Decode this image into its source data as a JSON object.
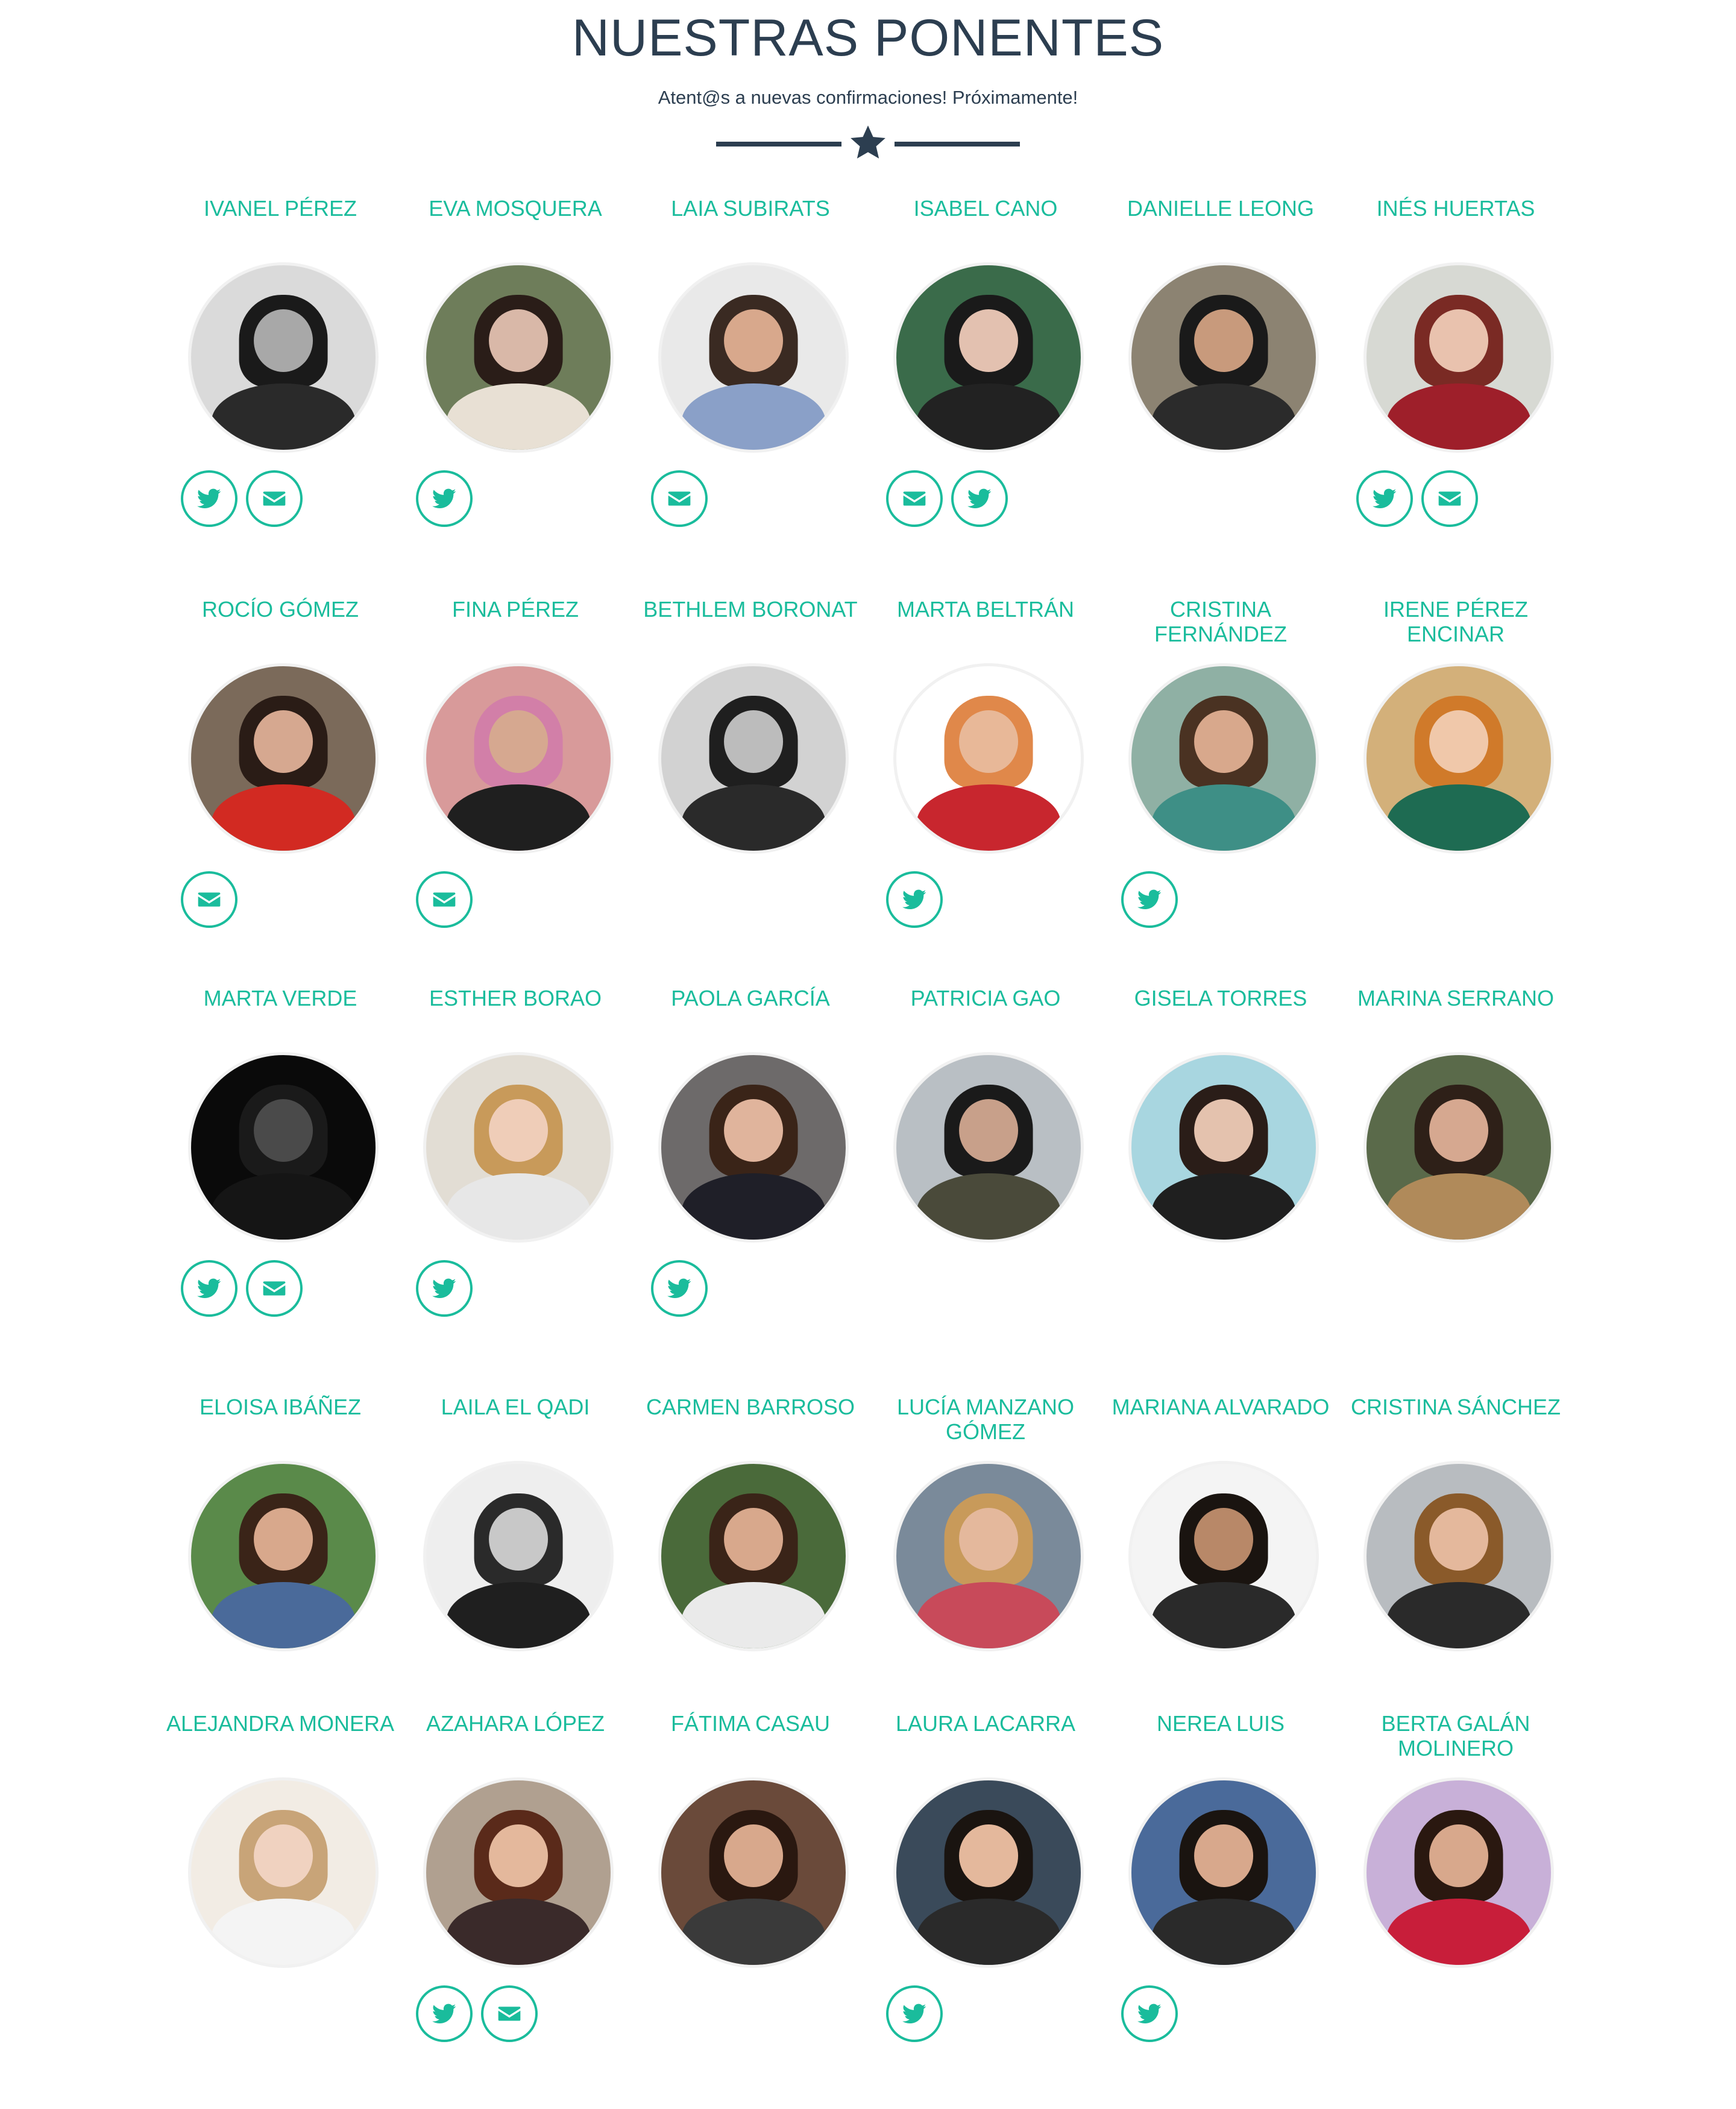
{
  "header": {
    "title": "NUESTRAS PONENTES",
    "subtitle": "Atent@s a nuevas confirmaciones! Próximamente!",
    "divider_icon": "star-icon"
  },
  "colors": {
    "accent": "#1abc9c",
    "heading": "#2c3e50",
    "background": "#ffffff"
  },
  "speakers": [
    {
      "name": "Ivanel Pérez",
      "icons": [
        "twitter-icon",
        "envelope-icon"
      ],
      "photo": {
        "bg": "#dadada",
        "hair": "#1a1a1a",
        "skin": "#a8a8a8",
        "clothes": "#2a2a2a"
      }
    },
    {
      "name": "Eva Mosquera",
      "icons": [
        "twitter-icon"
      ],
      "photo": {
        "bg": "#6e7d5a",
        "hair": "#2a1d18",
        "skin": "#d9b8a8",
        "clothes": "#e8e0d4"
      }
    },
    {
      "name": "Laia Subirats",
      "icons": [
        "envelope-icon"
      ],
      "photo": {
        "bg": "#e9e9e9",
        "hair": "#3a2a22",
        "skin": "#d8a88c",
        "clothes": "#8aa0c8"
      }
    },
    {
      "name": "Isabel Cano",
      "icons": [
        "envelope-icon",
        "twitter-icon"
      ],
      "photo": {
        "bg": "#3a6b4a",
        "hair": "#1a1a1a",
        "skin": "#e3c1b0",
        "clothes": "#222222"
      }
    },
    {
      "name": "Danielle Leong",
      "icons": [],
      "photo": {
        "bg": "#8c8372",
        "hair": "#1a1a1a",
        "skin": "#c89a7c",
        "clothes": "#2b2b2b"
      }
    },
    {
      "name": "Inés Huertas",
      "icons": [
        "twitter-icon",
        "envelope-icon"
      ],
      "photo": {
        "bg": "#d7d9d3",
        "hair": "#7a2a24",
        "skin": "#e9c2ae",
        "clothes": "#9e1f2a"
      }
    },
    {
      "name": "Rocío Gómez",
      "icons": [
        "envelope-icon"
      ],
      "photo": {
        "bg": "#7b6a5a",
        "hair": "#2a1c16",
        "skin": "#d6a890",
        "clothes": "#d22a22"
      }
    },
    {
      "name": "Fina Pérez",
      "icons": [
        "envelope-icon"
      ],
      "photo": {
        "bg": "#d89a9a",
        "hair": "#d27fa8",
        "skin": "#d6a890",
        "clothes": "#1f1f1f"
      }
    },
    {
      "name": "Bethlem Boronat",
      "icons": [],
      "photo": {
        "bg": "#d2d2d2",
        "hair": "#1f1f1f",
        "skin": "#bcbcbc",
        "clothes": "#2a2a2a"
      }
    },
    {
      "name": "Marta Beltrán",
      "icons": [
        "twitter-icon"
      ],
      "photo": {
        "bg": "#ffffff",
        "hair": "#e0884a",
        "skin": "#e8b898",
        "clothes": "#c8262e"
      }
    },
    {
      "name": "Cristina Fernández",
      "icons": [
        "twitter-icon"
      ],
      "photo": {
        "bg": "#8fb0a4",
        "hair": "#4a3222",
        "skin": "#d8a88c",
        "clothes": "#3e8f86"
      }
    },
    {
      "name": "Irene Pérez Encinar",
      "icons": [],
      "photo": {
        "bg": "#d3b07a",
        "hair": "#d07a2a",
        "skin": "#f0c8aa",
        "clothes": "#1e6b52"
      }
    },
    {
      "name": "Marta Verde",
      "icons": [
        "twitter-icon",
        "envelope-icon"
      ],
      "photo": {
        "bg": "#0a0a0a",
        "hair": "#1a1a1a",
        "skin": "#4a4a4a",
        "clothes": "#151515"
      }
    },
    {
      "name": "Esther Borao",
      "icons": [
        "twitter-icon"
      ],
      "photo": {
        "bg": "#e2ddd4",
        "hair": "#c89a5a",
        "skin": "#efcdb8",
        "clothes": "#e7e7e7"
      }
    },
    {
      "name": "Paola García",
      "icons": [
        "twitter-icon"
      ],
      "photo": {
        "bg": "#6d6a6a",
        "hair": "#3a2418",
        "skin": "#e0b49c",
        "clothes": "#1f1f28"
      }
    },
    {
      "name": "Patricia Gao",
      "icons": [],
      "photo": {
        "bg": "#b9bfc4",
        "hair": "#1a1a1a",
        "skin": "#c8a08a",
        "clothes": "#4a4a3a"
      }
    },
    {
      "name": "Gisela Torres",
      "icons": [],
      "photo": {
        "bg": "#a8d6e0",
        "hair": "#2a1d18",
        "skin": "#e4c2ae",
        "clothes": "#1f1f1f"
      }
    },
    {
      "name": "Marina Serrano",
      "icons": [],
      "photo": {
        "bg": "#5a6a4a",
        "hair": "#2e2018",
        "skin": "#d6a890",
        "clothes": "#b08a5a"
      }
    },
    {
      "name": "Eloisa Ibáñez",
      "icons": [],
      "photo": {
        "bg": "#5a8a4a",
        "hair": "#3a2418",
        "skin": "#d8a88c",
        "clothes": "#4a6a9a"
      }
    },
    {
      "name": "Laila El Qadi",
      "icons": [],
      "photo": {
        "bg": "#eeeeee",
        "hair": "#2a2a2a",
        "skin": "#c8c8c8",
        "clothes": "#1f1f1f"
      }
    },
    {
      "name": "Carmen Barroso",
      "icons": [],
      "photo": {
        "bg": "#4a6a3a",
        "hair": "#3a2418",
        "skin": "#d8a88c",
        "clothes": "#eaeaea"
      }
    },
    {
      "name": "Lucía Manzano Gómez",
      "icons": [],
      "photo": {
        "bg": "#7a8a9a",
        "hair": "#c89a5a",
        "skin": "#e4b89c",
        "clothes": "#c84a5a"
      }
    },
    {
      "name": "Mariana Alvarado",
      "icons": [],
      "photo": {
        "bg": "#f4f4f4",
        "hair": "#1a1410",
        "skin": "#b88868",
        "clothes": "#2a2a2a"
      }
    },
    {
      "name": "Cristina Sánchez",
      "icons": [],
      "photo": {
        "bg": "#b8bcc0",
        "hair": "#8a5a2a",
        "skin": "#e4b89c",
        "clothes": "#2a2a2a"
      }
    },
    {
      "name": "Alejandra Monera",
      "icons": [],
      "photo": {
        "bg": "#f2ece4",
        "hair": "#c8a478",
        "skin": "#f0d2c0",
        "clothes": "#f4f4f4"
      }
    },
    {
      "name": "Azahara López",
      "icons": [
        "twitter-icon",
        "envelope-icon"
      ],
      "photo": {
        "bg": "#b0a090",
        "hair": "#5a2a1a",
        "skin": "#e4b89c",
        "clothes": "#3a2a2a"
      }
    },
    {
      "name": "Fátima Casau",
      "icons": [],
      "photo": {
        "bg": "#6a4a3a",
        "hair": "#2a1810",
        "skin": "#d8a88c",
        "clothes": "#3a3a3a"
      }
    },
    {
      "name": "Laura Lacarra",
      "icons": [
        "twitter-icon"
      ],
      "photo": {
        "bg": "#3a4a5a",
        "hair": "#1a1410",
        "skin": "#e4b89c",
        "clothes": "#2a2a2a"
      }
    },
    {
      "name": "Nerea Luis",
      "icons": [
        "twitter-icon"
      ],
      "photo": {
        "bg": "#4a6a9a",
        "hair": "#1a1410",
        "skin": "#d8a88c",
        "clothes": "#2a2a2a"
      }
    },
    {
      "name": "Berta Galán Molinero",
      "icons": [],
      "photo": {
        "bg": "#c8b0d8",
        "hair": "#2a1810",
        "skin": "#d8a88c",
        "clothes": "#c81e3a"
      }
    }
  ]
}
